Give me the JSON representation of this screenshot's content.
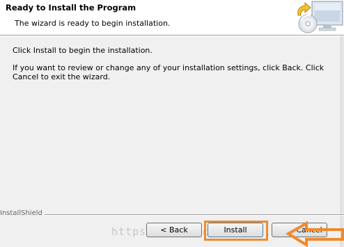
{
  "header": {
    "title": "Ready to Install the Program",
    "subtitle": "The wizard is ready to begin installation."
  },
  "body": {
    "line1": "Click Install to begin the installation.",
    "line2": "If you want to review or change any of your installation settings, click Back. Click Cancel to exit the wizard."
  },
  "footer": {
    "brand": "InstallShield",
    "buttons": {
      "back": "< Back",
      "install": "Install",
      "cancel": "Cancel"
    }
  },
  "overlay": {
    "watermark": "https://blog.csdn.net/...",
    "highlight_color": "#ee8a2e"
  },
  "icons": {
    "header_graphic": "computer-cd-icon"
  }
}
